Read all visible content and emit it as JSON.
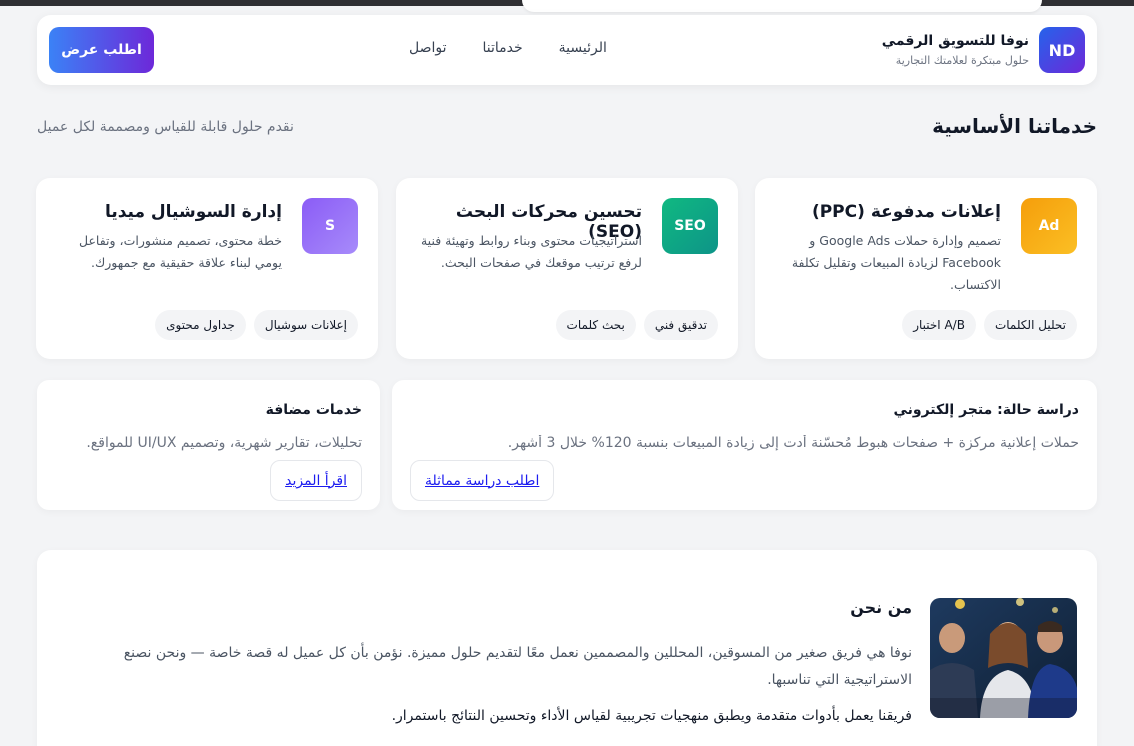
{
  "header": {
    "logo_text": "ND",
    "brand_name": "نوفا للتسويق الرقمي",
    "tagline": "حلول مبتكرة لعلامتك التجارية",
    "nav": [
      {
        "label": "الرئيسية"
      },
      {
        "label": "خدماتنا"
      },
      {
        "label": "تواصل"
      }
    ],
    "cta_label": "اطلب عرض"
  },
  "services_section": {
    "title": "خدماتنا الأساسية",
    "subtitle": "نقدم حلول قابلة للقياس ومصممة لكل عميل",
    "cards": [
      {
        "icon": "Ad",
        "icon_color": "#f59e0b",
        "title": "إعلانات مدفوعة (PPC)",
        "description": "تصميم وإدارة حملات Google Ads و Facebook لزيادة المبيعات وتقليل تكلفة الاكتساب.",
        "tags": [
          "تحليل الكلمات",
          "A/B اختبار"
        ]
      },
      {
        "icon": "SEO",
        "icon_color": "#10b981",
        "title": "تحسين محركات البحث (SEO)",
        "description": "استراتيجيات محتوى وبناء روابط وتهيئة فنية لرفع ترتيب موقعك في صفحات البحث.",
        "tags": [
          "تدقيق فني",
          "بحث كلمات"
        ]
      },
      {
        "icon": "S",
        "icon_color": "#8b5cf6",
        "title": "إدارة السوشيال ميديا",
        "description": "خطة محتوى، تصميم منشورات، وتفاعل يومي لبناء علاقة حقيقية مع جمهورك.",
        "tags": [
          "إعلانات سوشيال",
          "جداول محتوى"
        ]
      }
    ]
  },
  "case_study": {
    "title": "دراسة حالة: متجر إلكتروني",
    "text": "حملات إعلانية مركزة + صفحات هبوط مُحسّنة أدت إلى زيادة المبيعات بنسبة 120% خلال 3 أشهر.",
    "button": "اطلب دراسة مماثلة"
  },
  "extra_services": {
    "title": "خدمات مضافة",
    "text": "تحليلات، تقارير شهرية، وتصميم UI/UX للمواقع.",
    "button": "اقرأ المزيد"
  },
  "about": {
    "title": "من نحن",
    "paragraph1": "نوفا هي فريق صغير من المسوقين، المحللين والمصممين نعمل معًا لتقديم حلول مميزة. نؤمن بأن كل عميل له قصة خاصة — ونحن نصنع الاستراتيجية التي تناسبها.",
    "paragraph2": "فريقنا يعمل بأدوات متقدمة ويطبق منهجيات تجريبية لقياس الأداء وتحسين النتائج باستمرار."
  }
}
